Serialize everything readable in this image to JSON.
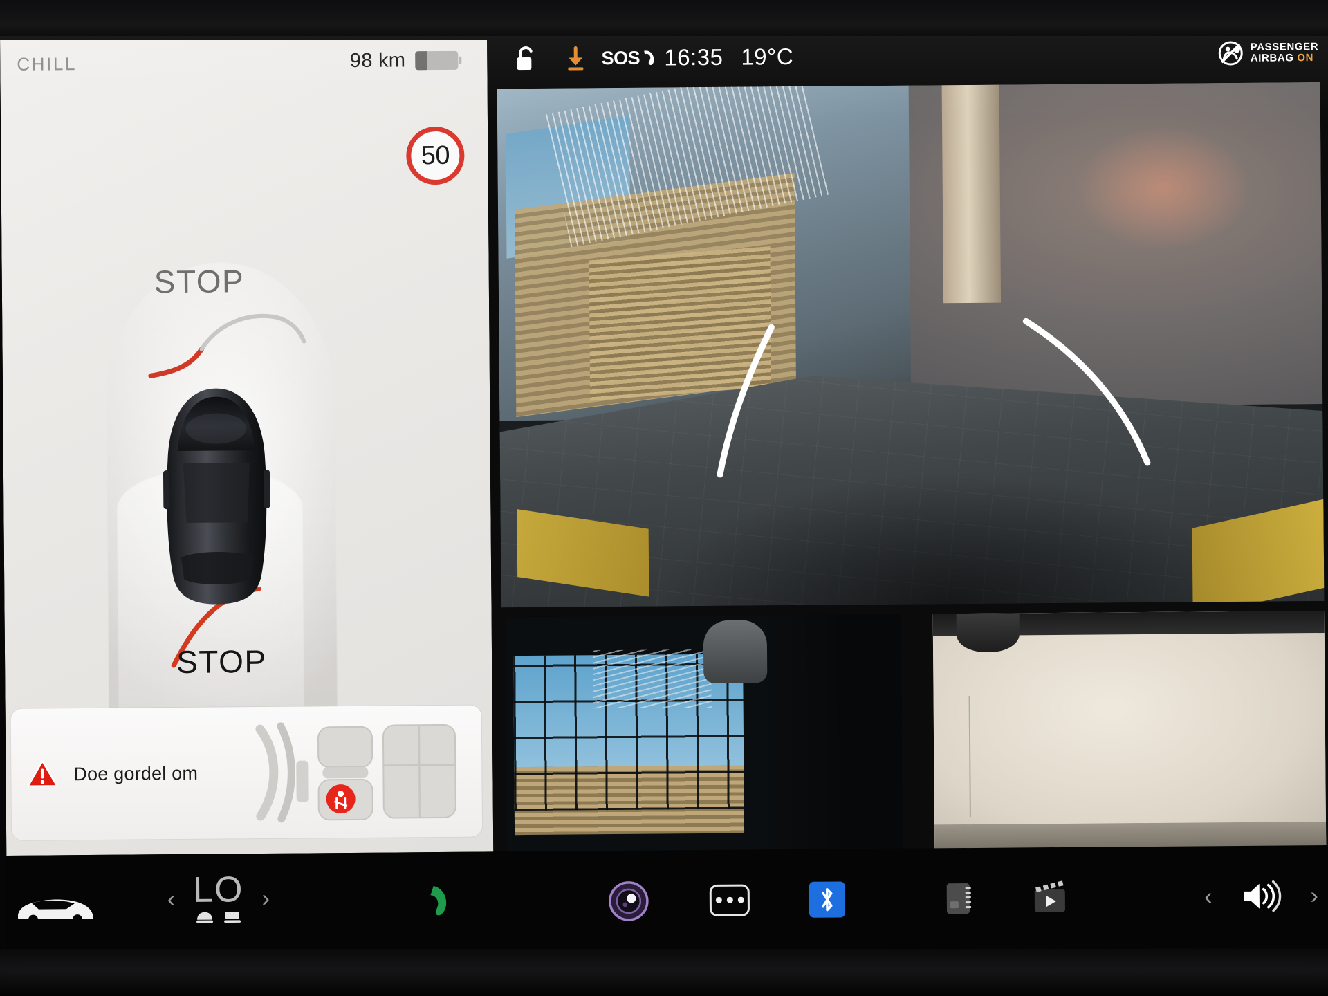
{
  "instrument": {
    "drive_mode": "CHILL",
    "range": "98 km",
    "battery_level_pct": 27,
    "speed_limit": "50",
    "speed_limit_color": "#d9392f",
    "parking_alert_front": "STOP",
    "parking_alert_rear": "STOP",
    "front_sensor_color": "#d1372c",
    "rear_sensor_color": "#d1372c"
  },
  "belt_card": {
    "warning_icon": "warning-triangle-icon",
    "message": "Doe gordel om",
    "seat_alert_icon": "seatbelt-reminder-icon",
    "seat_alert_color": "#e8251b"
  },
  "status_bar": {
    "lock_icon": "unlocked-padlock-icon",
    "download_icon": "software-update-download-icon",
    "download_color": "#e2892b",
    "sos_label": "SOS",
    "sos_icon": "phone-handset-icon",
    "time": "16:35",
    "temperature": "19°C",
    "airbag_icon": "passenger-airbag-icon",
    "airbag_line1": "PASSENGER",
    "airbag_line2_prefix": "AIRBAG",
    "airbag_line2_state": "ON",
    "airbag_state_color": "#f0a03c"
  },
  "cameras": {
    "main": "rear-backup-camera-view",
    "rear_left": "left-repeater-camera-view",
    "rear_right": "right-repeater-camera-view",
    "guideline_color": "#ffffff"
  },
  "toolbar": {
    "car_icon": "vehicle-controls-icon",
    "climate_left_value": "LO",
    "prev_icon": "chevron-left-icon",
    "next_icon": "chevron-right-icon",
    "seat_heater_icons": [
      "front-seat-heater-icon",
      "rear-seat-heater-icon"
    ],
    "phone_icon": "phone-call-icon",
    "phone_color": "#1f9c4b",
    "dashcam_icon": "dashcam-lens-icon",
    "dashcam_color": "#8e6fb8",
    "more_icon": "more-options-icon",
    "bluetooth_icon": "bluetooth-icon",
    "bluetooth_color": "#1d6fe0",
    "card_icon": "media-card-icon",
    "theater_icon": "tesla-theater-icon",
    "volume_icon": "volume-speaker-icon"
  }
}
